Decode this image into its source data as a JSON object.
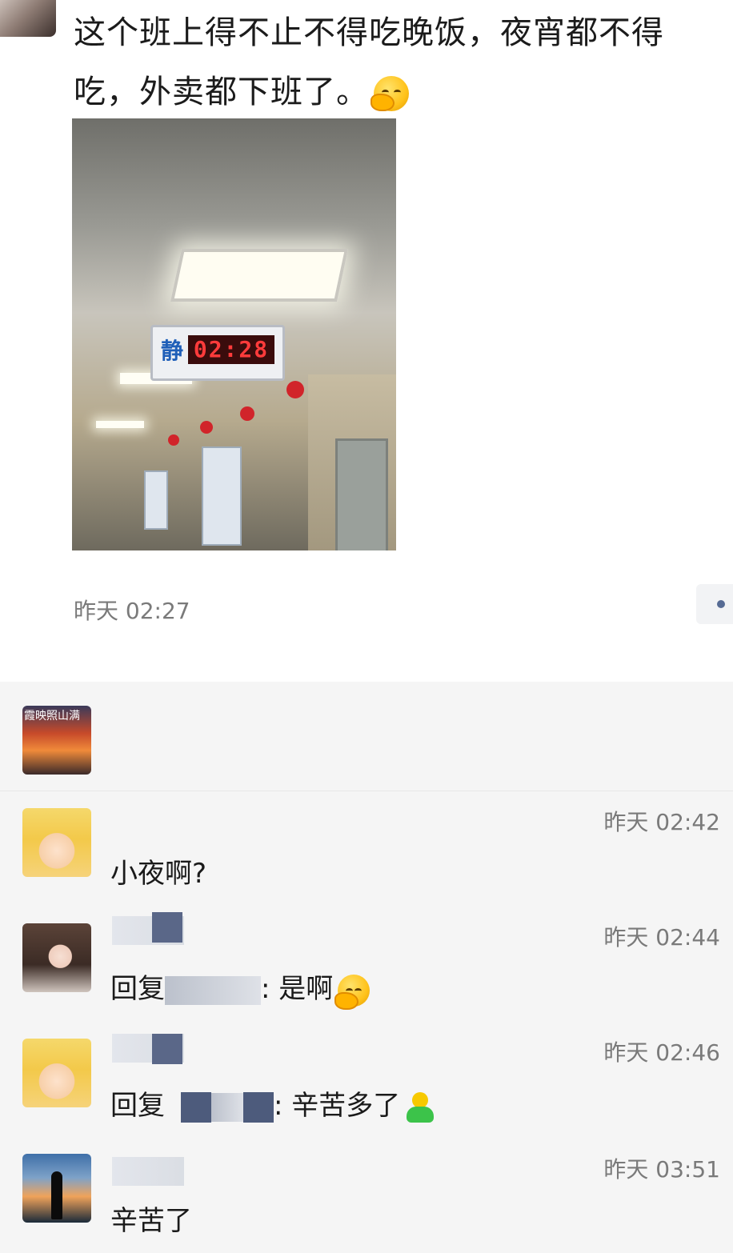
{
  "post": {
    "text": "这个班上得不止不得吃晚饭，夜宵都不得\n吃，外卖都下班了。",
    "emoji": "facepalm-laughing-emoji",
    "time": "昨天 02:27",
    "photo": {
      "clock_char": "静",
      "clock_digits": "02:28"
    }
  },
  "comments": [
    {
      "avatar": "baby-avatar",
      "time": "昨天 02:42",
      "text": "小夜啊?"
    },
    {
      "avatar": "girl-avatar",
      "time": "昨天 02:44",
      "reply_prefix": "回复",
      "separator": ":",
      "text": "是啊",
      "emoji": "facepalm-laughing-emoji"
    },
    {
      "avatar": "baby-avatar",
      "time": "昨天 02:46",
      "reply_prefix": "回复",
      "separator": ":",
      "text": "辛苦多了",
      "emoji": "green-person-emoji"
    },
    {
      "avatar": "sea-avatar",
      "time": "昨天 03:51",
      "text": "辛苦了"
    }
  ],
  "like_avatar_caption": "霞映照山满"
}
